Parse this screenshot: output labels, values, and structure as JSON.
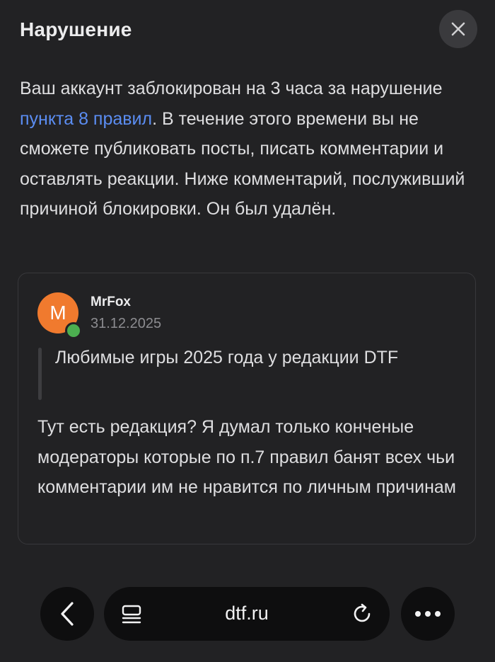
{
  "dialog": {
    "title": "Нарушение",
    "close_icon": "close-icon",
    "message": {
      "part1": "Ваш аккаунт заблокирован на 3 часа за нарушение ",
      "link": "пункта 8 правил",
      "part2": ". В течение этого времени вы не сможете публиковать посты, писать комментарии и оставлять реакции. Ниже комментарий, послуживший причиной блокировки. Он был удалён."
    },
    "link_color": "#5b8df2"
  },
  "comment": {
    "avatar_letter": "M",
    "avatar_color": "#f07a2e",
    "online_color": "#4caf50",
    "author": "MrFox",
    "date": "31.12.2025",
    "quote": "Любимые игры 2025 года у редакции DTF",
    "text": "Тут есть редакция? Я думал только конченые модераторы которые по п.7 правил банят всех чьи комментарии им не нравится по личным причинам"
  },
  "browser": {
    "back_icon": "chevron-left-icon",
    "reader_icon": "reader-mode-icon",
    "url": "dtf.ru",
    "reload_icon": "reload-icon",
    "more_icon": "more-dots-icon"
  }
}
